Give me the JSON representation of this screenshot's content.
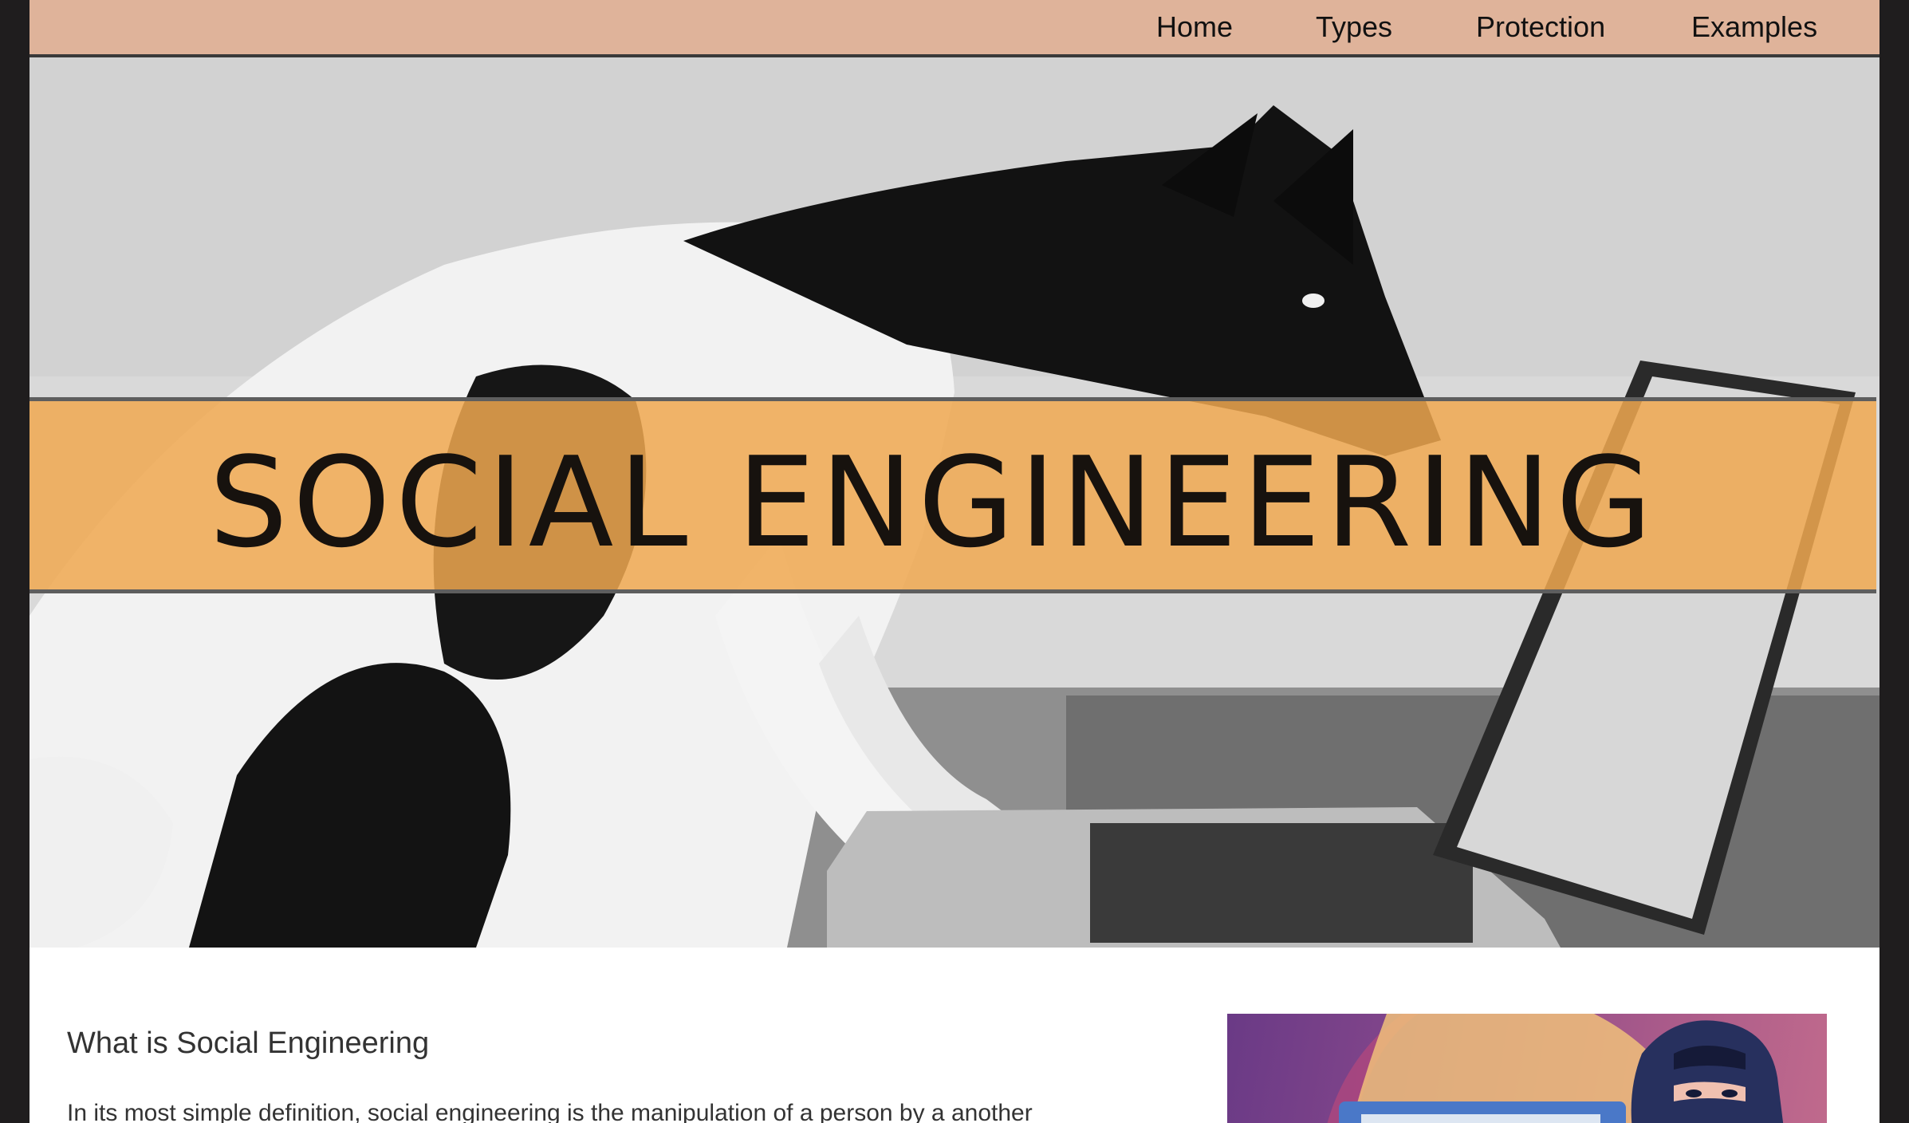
{
  "nav": {
    "items": [
      {
        "label": "Home"
      },
      {
        "label": "Types"
      },
      {
        "label": "Protection"
      },
      {
        "label": "Examples"
      }
    ]
  },
  "hero": {
    "title": "SOCIAL ENGINEERING"
  },
  "content": {
    "heading": "What is Social Engineering",
    "paragraph": "In its most simple definition, social engineering is the manipulation of a person by a another"
  },
  "colors": {
    "nav_background": "#dfb39a",
    "banner": "#f0a850",
    "page_background": "#1f1d1e"
  }
}
